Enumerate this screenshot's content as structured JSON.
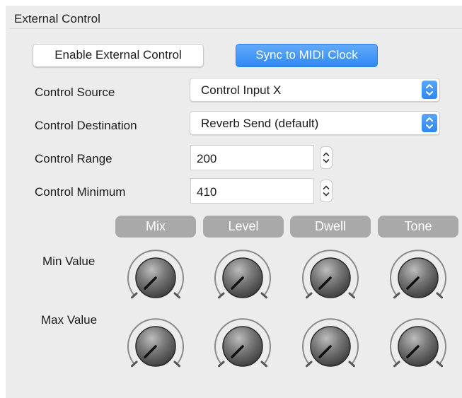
{
  "panel": {
    "title": "External Control"
  },
  "buttons": {
    "enable_label": "Enable External Control",
    "sync_label": "Sync to MIDI Clock",
    "sync_color": "#2e8af6"
  },
  "controls": {
    "source": {
      "label": "Control Source",
      "value": "Control Input X"
    },
    "destination": {
      "label": "Control Destination",
      "value": "Reverb Send (default)"
    },
    "range": {
      "label": "Control Range",
      "value": "200"
    },
    "minimum": {
      "label": "Control Minimum",
      "value": "410"
    }
  },
  "knobs": {
    "headers": [
      "Mix",
      "Level",
      "Dwell",
      "Tone"
    ],
    "row_labels": {
      "min": "Min Value",
      "max": "Max Value"
    },
    "header_color": "#a9a9a9"
  }
}
